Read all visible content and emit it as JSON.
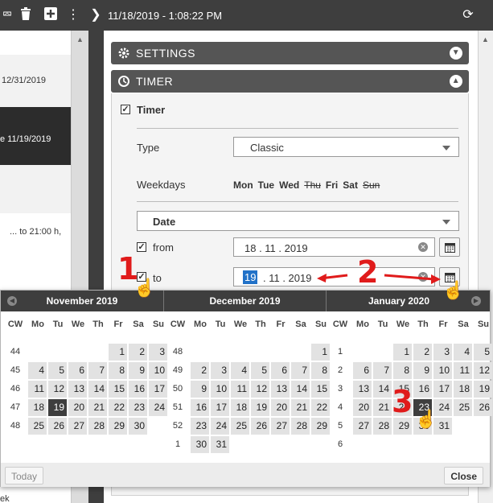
{
  "toolbar": {
    "timestamp": "11/18/2019 - 1:08:22 PM",
    "icons": [
      "expand-icon",
      "trash-icon",
      "add-icon",
      "more-icon",
      "chevron-right-icon",
      "refresh-icon"
    ]
  },
  "left_panel": {
    "rows": [
      "12/31/2019",
      "e 11/19/2019",
      "... to 21:00 h,",
      "ek"
    ]
  },
  "settings": {
    "label": "SETTINGS"
  },
  "timer": {
    "label": "TIMER",
    "checkbox_label": "Timer",
    "type_label": "Type",
    "type_value": "Classic",
    "weekdays_label": "Weekdays",
    "weekdays": [
      {
        "name": "Mon",
        "active": true
      },
      {
        "name": "Tue",
        "active": true
      },
      {
        "name": "Wed",
        "active": true
      },
      {
        "name": "Thu",
        "active": false
      },
      {
        "name": "Fri",
        "active": true
      },
      {
        "name": "Sat",
        "active": true
      },
      {
        "name": "Sun",
        "active": false
      }
    ],
    "date_mode": "Date",
    "from_label": "from",
    "from_value": "18 . 11 . 2019",
    "to_label": "to",
    "to_day": "19",
    "to_rest": ". 11 . 2019"
  },
  "annotations": [
    "1",
    "2",
    "3"
  ],
  "datepicker": {
    "headers": [
      "CW",
      "Mo",
      "Tu",
      "We",
      "Th",
      "Fr",
      "Sa",
      "Su"
    ],
    "today_label": "Today",
    "close_label": "Close",
    "months": [
      {
        "title": "November 2019",
        "cws": [
          "44",
          "45",
          "46",
          "47",
          "48"
        ],
        "offset": 4,
        "days": 30,
        "selected": 19
      },
      {
        "title": "December 2019",
        "cws": [
          "48",
          "49",
          "50",
          "51",
          "52",
          "1"
        ],
        "offset": 6,
        "days": 31,
        "selected": null
      },
      {
        "title": "January 2020",
        "cws": [
          "1",
          "2",
          "3",
          "4",
          "5",
          "6"
        ],
        "offset": 2,
        "days": 31,
        "selected": 23
      }
    ]
  }
}
